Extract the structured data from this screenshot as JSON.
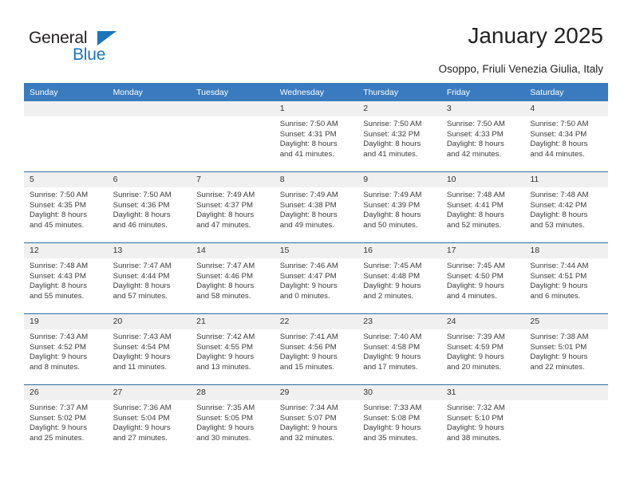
{
  "brand": {
    "name_part1": "General",
    "name_part2": "Blue",
    "triangle_color": "#1b75bb",
    "text_color": "#231f20"
  },
  "header": {
    "title": "January 2025",
    "subtitle": "Osoppo, Friuli Venezia Giulia, Italy"
  },
  "theme": {
    "header_bg": "#3a7bbf",
    "row_border": "#2e6da4",
    "daynum_bg": "#f0f0f0"
  },
  "weekday_headers": [
    "Sunday",
    "Monday",
    "Tuesday",
    "Wednesday",
    "Thursday",
    "Friday",
    "Saturday"
  ],
  "weeks": [
    [
      {
        "day": "",
        "blank": true
      },
      {
        "day": "",
        "blank": true
      },
      {
        "day": "",
        "blank": true
      },
      {
        "day": "1",
        "sunrise": "Sunrise: 7:50 AM",
        "sunset": "Sunset: 4:31 PM",
        "daylight_line1": "Daylight: 8 hours",
        "daylight_line2": "and 41 minutes."
      },
      {
        "day": "2",
        "sunrise": "Sunrise: 7:50 AM",
        "sunset": "Sunset: 4:32 PM",
        "daylight_line1": "Daylight: 8 hours",
        "daylight_line2": "and 41 minutes."
      },
      {
        "day": "3",
        "sunrise": "Sunrise: 7:50 AM",
        "sunset": "Sunset: 4:33 PM",
        "daylight_line1": "Daylight: 8 hours",
        "daylight_line2": "and 42 minutes."
      },
      {
        "day": "4",
        "sunrise": "Sunrise: 7:50 AM",
        "sunset": "Sunset: 4:34 PM",
        "daylight_line1": "Daylight: 8 hours",
        "daylight_line2": "and 44 minutes."
      }
    ],
    [
      {
        "day": "5",
        "sunrise": "Sunrise: 7:50 AM",
        "sunset": "Sunset: 4:35 PM",
        "daylight_line1": "Daylight: 8 hours",
        "daylight_line2": "and 45 minutes."
      },
      {
        "day": "6",
        "sunrise": "Sunrise: 7:50 AM",
        "sunset": "Sunset: 4:36 PM",
        "daylight_line1": "Daylight: 8 hours",
        "daylight_line2": "and 46 minutes."
      },
      {
        "day": "7",
        "sunrise": "Sunrise: 7:49 AM",
        "sunset": "Sunset: 4:37 PM",
        "daylight_line1": "Daylight: 8 hours",
        "daylight_line2": "and 47 minutes."
      },
      {
        "day": "8",
        "sunrise": "Sunrise: 7:49 AM",
        "sunset": "Sunset: 4:38 PM",
        "daylight_line1": "Daylight: 8 hours",
        "daylight_line2": "and 49 minutes."
      },
      {
        "day": "9",
        "sunrise": "Sunrise: 7:49 AM",
        "sunset": "Sunset: 4:39 PM",
        "daylight_line1": "Daylight: 8 hours",
        "daylight_line2": "and 50 minutes."
      },
      {
        "day": "10",
        "sunrise": "Sunrise: 7:48 AM",
        "sunset": "Sunset: 4:41 PM",
        "daylight_line1": "Daylight: 8 hours",
        "daylight_line2": "and 52 minutes."
      },
      {
        "day": "11",
        "sunrise": "Sunrise: 7:48 AM",
        "sunset": "Sunset: 4:42 PM",
        "daylight_line1": "Daylight: 8 hours",
        "daylight_line2": "and 53 minutes."
      }
    ],
    [
      {
        "day": "12",
        "sunrise": "Sunrise: 7:48 AM",
        "sunset": "Sunset: 4:43 PM",
        "daylight_line1": "Daylight: 8 hours",
        "daylight_line2": "and 55 minutes."
      },
      {
        "day": "13",
        "sunrise": "Sunrise: 7:47 AM",
        "sunset": "Sunset: 4:44 PM",
        "daylight_line1": "Daylight: 8 hours",
        "daylight_line2": "and 57 minutes."
      },
      {
        "day": "14",
        "sunrise": "Sunrise: 7:47 AM",
        "sunset": "Sunset: 4:46 PM",
        "daylight_line1": "Daylight: 8 hours",
        "daylight_line2": "and 58 minutes."
      },
      {
        "day": "15",
        "sunrise": "Sunrise: 7:46 AM",
        "sunset": "Sunset: 4:47 PM",
        "daylight_line1": "Daylight: 9 hours",
        "daylight_line2": "and 0 minutes."
      },
      {
        "day": "16",
        "sunrise": "Sunrise: 7:45 AM",
        "sunset": "Sunset: 4:48 PM",
        "daylight_line1": "Daylight: 9 hours",
        "daylight_line2": "and 2 minutes."
      },
      {
        "day": "17",
        "sunrise": "Sunrise: 7:45 AM",
        "sunset": "Sunset: 4:50 PM",
        "daylight_line1": "Daylight: 9 hours",
        "daylight_line2": "and 4 minutes."
      },
      {
        "day": "18",
        "sunrise": "Sunrise: 7:44 AM",
        "sunset": "Sunset: 4:51 PM",
        "daylight_line1": "Daylight: 9 hours",
        "daylight_line2": "and 6 minutes."
      }
    ],
    [
      {
        "day": "19",
        "sunrise": "Sunrise: 7:43 AM",
        "sunset": "Sunset: 4:52 PM",
        "daylight_line1": "Daylight: 9 hours",
        "daylight_line2": "and 8 minutes."
      },
      {
        "day": "20",
        "sunrise": "Sunrise: 7:43 AM",
        "sunset": "Sunset: 4:54 PM",
        "daylight_line1": "Daylight: 9 hours",
        "daylight_line2": "and 11 minutes."
      },
      {
        "day": "21",
        "sunrise": "Sunrise: 7:42 AM",
        "sunset": "Sunset: 4:55 PM",
        "daylight_line1": "Daylight: 9 hours",
        "daylight_line2": "and 13 minutes."
      },
      {
        "day": "22",
        "sunrise": "Sunrise: 7:41 AM",
        "sunset": "Sunset: 4:56 PM",
        "daylight_line1": "Daylight: 9 hours",
        "daylight_line2": "and 15 minutes."
      },
      {
        "day": "23",
        "sunrise": "Sunrise: 7:40 AM",
        "sunset": "Sunset: 4:58 PM",
        "daylight_line1": "Daylight: 9 hours",
        "daylight_line2": "and 17 minutes."
      },
      {
        "day": "24",
        "sunrise": "Sunrise: 7:39 AM",
        "sunset": "Sunset: 4:59 PM",
        "daylight_line1": "Daylight: 9 hours",
        "daylight_line2": "and 20 minutes."
      },
      {
        "day": "25",
        "sunrise": "Sunrise: 7:38 AM",
        "sunset": "Sunset: 5:01 PM",
        "daylight_line1": "Daylight: 9 hours",
        "daylight_line2": "and 22 minutes."
      }
    ],
    [
      {
        "day": "26",
        "sunrise": "Sunrise: 7:37 AM",
        "sunset": "Sunset: 5:02 PM",
        "daylight_line1": "Daylight: 9 hours",
        "daylight_line2": "and 25 minutes."
      },
      {
        "day": "27",
        "sunrise": "Sunrise: 7:36 AM",
        "sunset": "Sunset: 5:04 PM",
        "daylight_line1": "Daylight: 9 hours",
        "daylight_line2": "and 27 minutes."
      },
      {
        "day": "28",
        "sunrise": "Sunrise: 7:35 AM",
        "sunset": "Sunset: 5:05 PM",
        "daylight_line1": "Daylight: 9 hours",
        "daylight_line2": "and 30 minutes."
      },
      {
        "day": "29",
        "sunrise": "Sunrise: 7:34 AM",
        "sunset": "Sunset: 5:07 PM",
        "daylight_line1": "Daylight: 9 hours",
        "daylight_line2": "and 32 minutes."
      },
      {
        "day": "30",
        "sunrise": "Sunrise: 7:33 AM",
        "sunset": "Sunset: 5:08 PM",
        "daylight_line1": "Daylight: 9 hours",
        "daylight_line2": "and 35 minutes."
      },
      {
        "day": "31",
        "sunrise": "Sunrise: 7:32 AM",
        "sunset": "Sunset: 5:10 PM",
        "daylight_line1": "Daylight: 9 hours",
        "daylight_line2": "and 38 minutes."
      },
      {
        "day": "",
        "blank": true
      }
    ]
  ]
}
